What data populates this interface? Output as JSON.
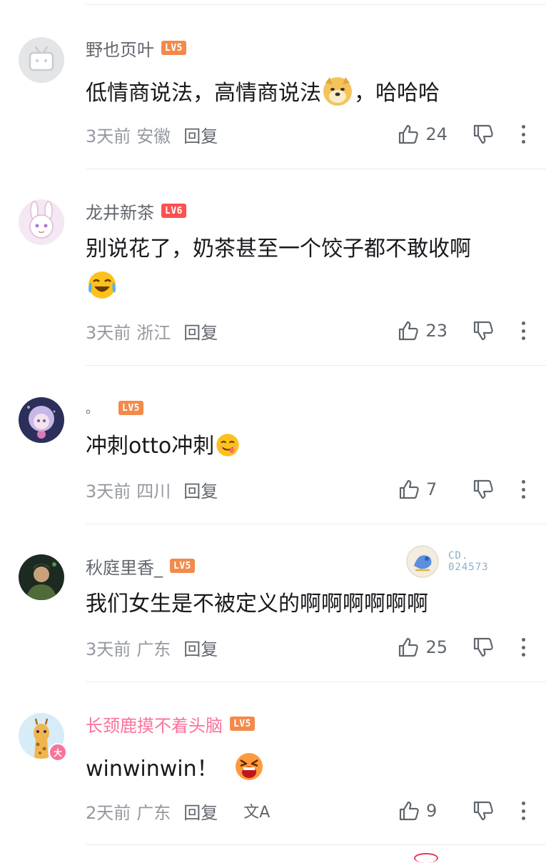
{
  "comments": [
    {
      "username": "野也页叶",
      "level": "LV5",
      "content": "低情商说法，高情商说法",
      "content_after_emoji": "，哈哈哈",
      "emoji": "doge-emoji",
      "time": "3天前",
      "location": "安徽",
      "reply_label": "回复",
      "likes": "24"
    },
    {
      "username": "龙井新茶",
      "level": "LV6",
      "content": "别说花了，奶茶甚至一个饺子都不敢收啊",
      "emoji": "laugh-cry-emoji",
      "time": "3天前",
      "location": "浙江",
      "reply_label": "回复",
      "likes": "23"
    },
    {
      "username": "。",
      "level": "LV5",
      "content": "冲刺otto冲刺",
      "emoji": "yummy-emoji",
      "time": "3天前",
      "location": "四川",
      "reply_label": "回复",
      "likes": "7"
    },
    {
      "username": "秋庭里香_",
      "level": "LV5",
      "content": "我们女生是不被定义的啊啊啊啊啊啊",
      "badge_line1": "CD.",
      "badge_line2": "024573",
      "time": "3天前",
      "location": "广东",
      "reply_label": "回复",
      "likes": "25"
    },
    {
      "username": "长颈鹿摸不着头脑",
      "level": "LV5",
      "content": "winwinwin！",
      "emoji": "shout-emoji",
      "vip_badge": "大",
      "time": "2天前",
      "location": "广东",
      "reply_label": "回复",
      "translate_icon": "文A",
      "likes": "9"
    }
  ],
  "colors": {
    "username": "#61666d",
    "vip_username": "#fb7299",
    "level_lv5": "#f28a4b",
    "level_lv6": "#ff4f4f",
    "meta": "#9499a0",
    "content": "#18191c"
  }
}
